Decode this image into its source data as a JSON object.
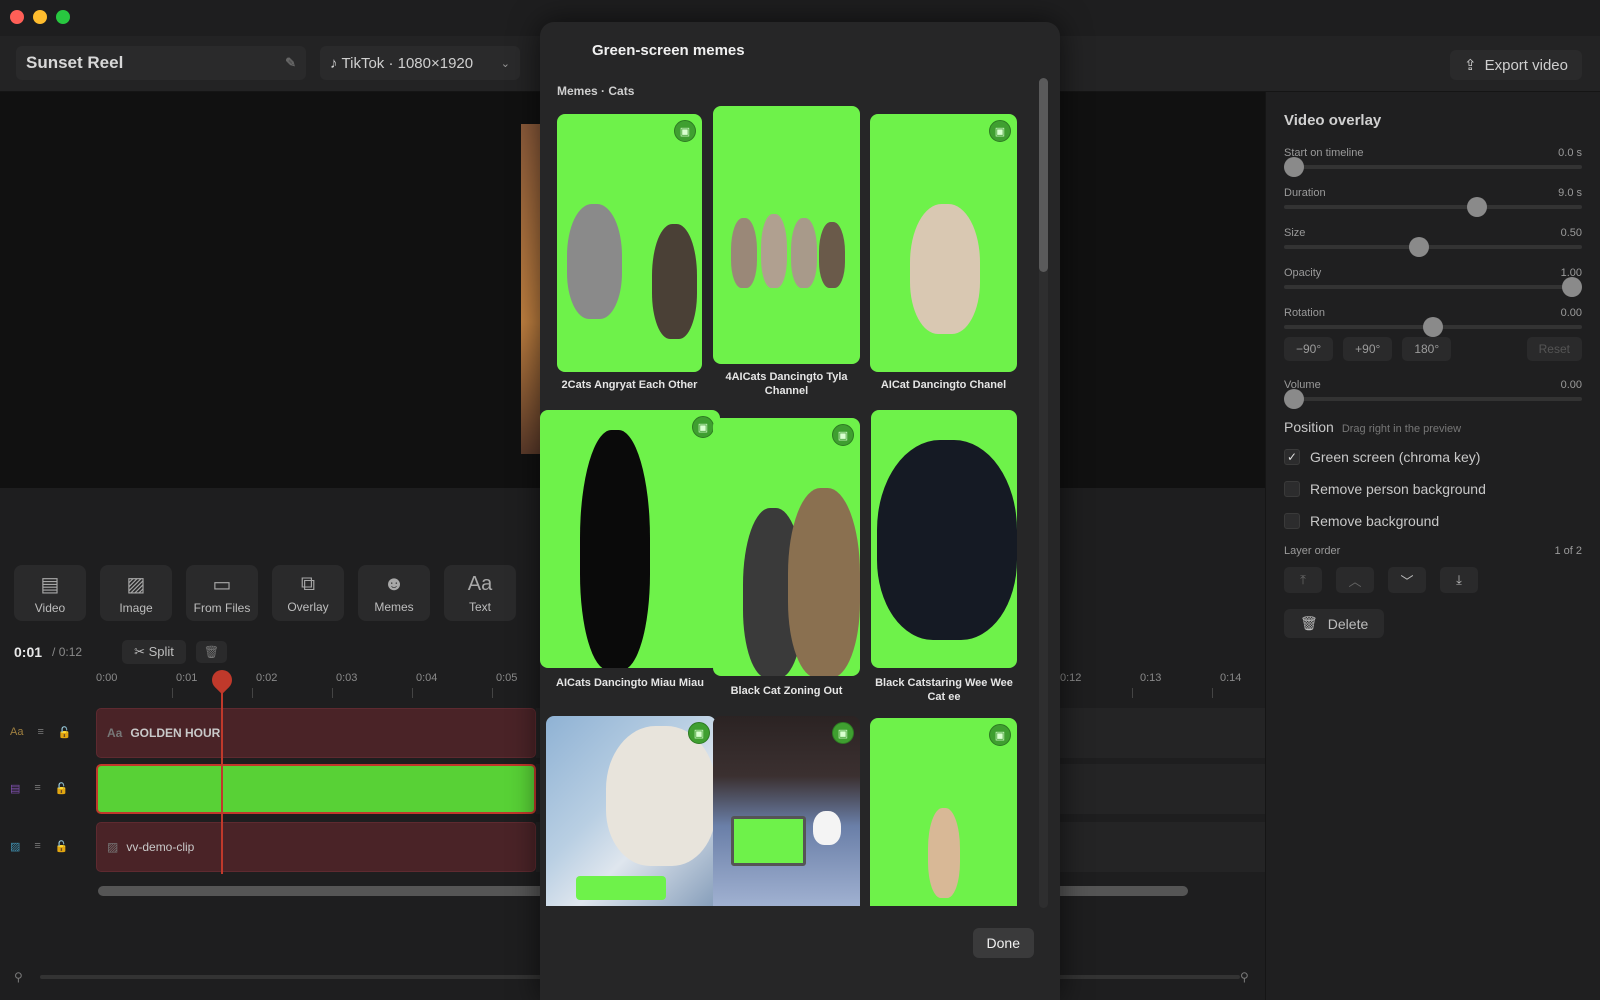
{
  "window": {
    "traffic_colors": [
      "#ff5f57",
      "#febc2e",
      "#28c840"
    ]
  },
  "header": {
    "project_name": "Sunset Reel",
    "format": "TikTok · 1080×1920",
    "export_label": "Export video"
  },
  "toolbar": {
    "items": [
      {
        "label": "Video",
        "icon": "film-icon"
      },
      {
        "label": "Image",
        "icon": "image-icon"
      },
      {
        "label": "From Files",
        "icon": "folder-icon"
      },
      {
        "label": "Overlay",
        "icon": "overlay-icon"
      },
      {
        "label": "Memes",
        "icon": "smiley-icon"
      },
      {
        "label": "Text",
        "icon": "text-icon"
      }
    ]
  },
  "timeline": {
    "current": "0:01",
    "total": "/ 0:12",
    "split_label": "Split",
    "ruler_left": [
      "0:00",
      "0:01",
      "0:02",
      "0:03",
      "0:04",
      "0:05"
    ],
    "ruler_right": [
      "0:12",
      "0:13",
      "0:14"
    ],
    "tracks": [
      {
        "type": "text",
        "label": "GOLDEN HOUR"
      },
      {
        "type": "video",
        "label": ""
      },
      {
        "type": "image",
        "label": "vv-demo-clip"
      }
    ]
  },
  "panel": {
    "title": "Video overlay",
    "sliders": [
      {
        "label": "Start on timeline",
        "value": "0.0 s",
        "fraction": 0.0
      },
      {
        "label": "Duration",
        "value": "9.0 s",
        "fraction": 0.66
      },
      {
        "label": "Size",
        "value": "0.50",
        "fraction": 0.45
      },
      {
        "label": "Opacity",
        "value": "1.00",
        "fraction": 1.0
      },
      {
        "label": "Rotation",
        "value": "0.00",
        "fraction": 0.5
      }
    ],
    "rotation_buttons": [
      "−90°",
      "+90°",
      "180°"
    ],
    "reset_label": "Reset",
    "volume": {
      "label": "Volume",
      "value": "0.00",
      "fraction": 0.0
    },
    "position_label": "Position",
    "position_hint": "Drag right in the preview",
    "checks": [
      {
        "label": "Green screen (chroma key)",
        "checked": true
      },
      {
        "label": "Remove person background",
        "checked": false
      },
      {
        "label": "Remove background",
        "checked": false
      }
    ],
    "layer_order_label": "Layer order",
    "layer_order_value": "1 of 2",
    "delete_label": "Delete"
  },
  "modal": {
    "title": "Green-screen memes",
    "section": "Memes · Cats",
    "items": [
      {
        "name": "2Cats Angryat Each Other"
      },
      {
        "name": "4AICats Dancingto Tyla Channel"
      },
      {
        "name": "AICat Dancingto Chanel"
      },
      {
        "name": "AICats Dancingto Miau Miau"
      },
      {
        "name": "Black Cat Zoning Out"
      },
      {
        "name": "Black Catstaring Wee Wee Cat ee"
      },
      {
        "name": ""
      },
      {
        "name": ""
      },
      {
        "name": ""
      }
    ],
    "done_label": "Done"
  }
}
